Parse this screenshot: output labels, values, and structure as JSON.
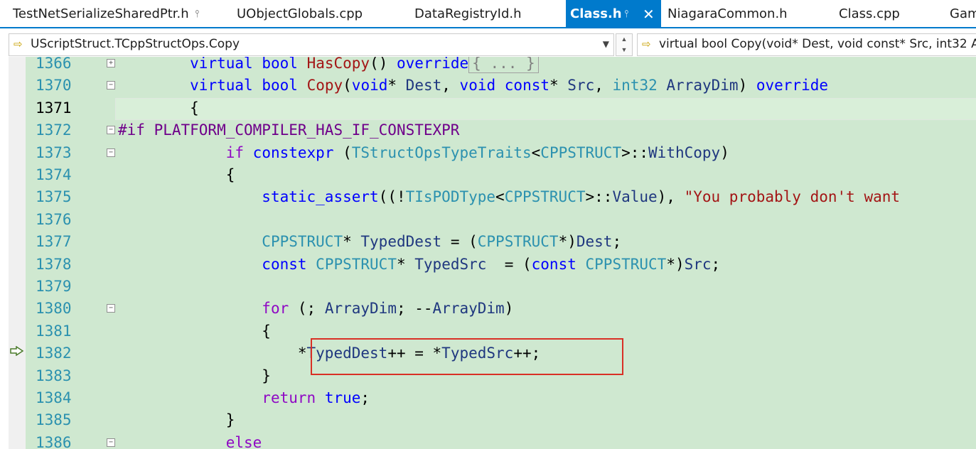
{
  "tabs": [
    {
      "label": "TestNetSerializeSharedPtr.h",
      "pinned": true,
      "active": false
    },
    {
      "label": "UObjectGlobals.cpp",
      "active": false
    },
    {
      "label": "DataRegistryId.h",
      "active": false
    },
    {
      "label": "Class.h",
      "pinned": true,
      "closable": true,
      "active": true
    },
    {
      "label": "NiagaraCommon.h",
      "active": false
    },
    {
      "label": "Class.cpp",
      "active": false
    },
    {
      "label": "Gam",
      "active": false
    }
  ],
  "nav": {
    "scope": "UScriptStruct.TCppStructOps.Copy",
    "member": "virtual bool Copy(void* Dest, void const* Src, int32 A"
  },
  "colors": {
    "accent": "#007acc",
    "editor_bg": "#cfe8d0",
    "highlight_box": "#d93025"
  },
  "icons": {
    "nav_scope": "method-icon",
    "nav_member": "method-icon",
    "execution": "execution-arrow-icon"
  },
  "editor": {
    "current_line": "1371",
    "execution_line": "1382",
    "lines": [
      {
        "num": "1366",
        "fold": "+",
        "tokens": [
          [
            "        ",
            ""
          ],
          [
            "virtual",
            "kw"
          ],
          [
            " ",
            ""
          ],
          [
            "bool",
            "kw"
          ],
          [
            " ",
            ""
          ],
          [
            "HasCopy",
            "fn2"
          ],
          [
            "() ",
            ""
          ],
          [
            "override",
            "kw"
          ]
        ],
        "collapsed": "{ ... }"
      },
      {
        "num": "1370",
        "fold": "-",
        "tokens": [
          [
            "        ",
            ""
          ],
          [
            "virtual",
            "kw"
          ],
          [
            " ",
            ""
          ],
          [
            "bool",
            "kw"
          ],
          [
            " ",
            ""
          ],
          [
            "Copy",
            "fn2"
          ],
          [
            "(",
            ""
          ],
          [
            "void",
            "kw"
          ],
          [
            "* ",
            ""
          ],
          [
            "Dest",
            "var"
          ],
          [
            ", ",
            ""
          ],
          [
            "void",
            "kw"
          ],
          [
            " ",
            ""
          ],
          [
            "const",
            "kw"
          ],
          [
            "* ",
            ""
          ],
          [
            "Src",
            "var"
          ],
          [
            ", ",
            ""
          ],
          [
            "int32",
            "ty"
          ],
          [
            " ",
            ""
          ],
          [
            "ArrayDim",
            "var"
          ],
          [
            ") ",
            ""
          ],
          [
            "override",
            "kw"
          ]
        ]
      },
      {
        "num": "1371",
        "fold": "",
        "tokens": [
          [
            "        {",
            ""
          ]
        ]
      },
      {
        "num": "1372",
        "fold": "-",
        "tokens": [
          [
            "#if ",
            "macro"
          ],
          [
            "PLATFORM_COMPILER_HAS_IF_CONSTEXPR",
            "macro"
          ]
        ]
      },
      {
        "num": "1373",
        "fold": "-",
        "tokens": [
          [
            "            ",
            ""
          ],
          [
            "if",
            "kw2"
          ],
          [
            " ",
            ""
          ],
          [
            "constexpr",
            "kw"
          ],
          [
            " (",
            ""
          ],
          [
            "TStructOpsTypeTraits",
            "ty"
          ],
          [
            "<",
            ""
          ],
          [
            "CPPSTRUCT",
            "ty"
          ],
          [
            ">::",
            ""
          ],
          [
            "WithCopy",
            "var"
          ],
          [
            ")",
            ""
          ]
        ]
      },
      {
        "num": "1374",
        "fold": "",
        "tokens": [
          [
            "            {",
            ""
          ]
        ]
      },
      {
        "num": "1375",
        "fold": "",
        "tokens": [
          [
            "                ",
            ""
          ],
          [
            "static_assert",
            "kw"
          ],
          [
            "((!",
            ""
          ],
          [
            "TIsPODType",
            "ty"
          ],
          [
            "<",
            ""
          ],
          [
            "CPPSTRUCT",
            "ty"
          ],
          [
            ">::",
            ""
          ],
          [
            "Value",
            "var"
          ],
          [
            "), ",
            ""
          ],
          [
            "\"You probably don't want",
            "str"
          ]
        ]
      },
      {
        "num": "1376",
        "fold": "",
        "tokens": []
      },
      {
        "num": "1377",
        "fold": "",
        "tokens": [
          [
            "                ",
            ""
          ],
          [
            "CPPSTRUCT",
            "ty"
          ],
          [
            "* ",
            ""
          ],
          [
            "TypedDest",
            "var"
          ],
          [
            " = (",
            ""
          ],
          [
            "CPPSTRUCT",
            "ty"
          ],
          [
            "*)",
            ""
          ],
          [
            "Dest",
            "var"
          ],
          [
            ";",
            ""
          ]
        ]
      },
      {
        "num": "1378",
        "fold": "",
        "tokens": [
          [
            "                ",
            ""
          ],
          [
            "const",
            "kw"
          ],
          [
            " ",
            ""
          ],
          [
            "CPPSTRUCT",
            "ty"
          ],
          [
            "* ",
            ""
          ],
          [
            "TypedSrc",
            "var"
          ],
          [
            "  = (",
            ""
          ],
          [
            "const",
            "kw"
          ],
          [
            " ",
            ""
          ],
          [
            "CPPSTRUCT",
            "ty"
          ],
          [
            "*)",
            ""
          ],
          [
            "Src",
            "var"
          ],
          [
            ";",
            ""
          ]
        ]
      },
      {
        "num": "1379",
        "fold": "",
        "tokens": []
      },
      {
        "num": "1380",
        "fold": "-",
        "tokens": [
          [
            "                ",
            ""
          ],
          [
            "for",
            "kw2"
          ],
          [
            " (; ",
            ""
          ],
          [
            "ArrayDim",
            "var"
          ],
          [
            "; --",
            ""
          ],
          [
            "ArrayDim",
            "var"
          ],
          [
            ")",
            ""
          ]
        ]
      },
      {
        "num": "1381",
        "fold": "",
        "tokens": [
          [
            "                {",
            ""
          ]
        ]
      },
      {
        "num": "1382",
        "fold": "",
        "tokens": [
          [
            "                    *",
            ""
          ],
          [
            "TypedDest",
            "var"
          ],
          [
            "++ = *",
            ""
          ],
          [
            "TypedSrc",
            "var"
          ],
          [
            "++;",
            ""
          ]
        ]
      },
      {
        "num": "1383",
        "fold": "",
        "tokens": [
          [
            "                }",
            ""
          ]
        ]
      },
      {
        "num": "1384",
        "fold": "",
        "tokens": [
          [
            "                ",
            ""
          ],
          [
            "return",
            "kw2"
          ],
          [
            " ",
            ""
          ],
          [
            "true",
            "kw"
          ],
          [
            ";",
            ""
          ]
        ]
      },
      {
        "num": "1385",
        "fold": "",
        "tokens": [
          [
            "            }",
            ""
          ]
        ]
      },
      {
        "num": "1386",
        "fold": "-",
        "tokens": [
          [
            "            ",
            ""
          ],
          [
            "else",
            "kw2"
          ]
        ]
      }
    ]
  }
}
